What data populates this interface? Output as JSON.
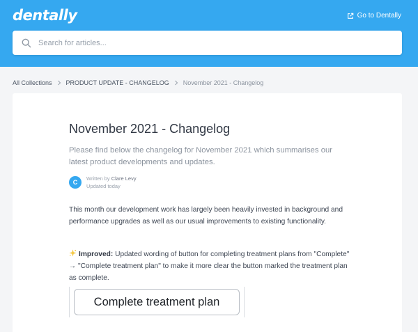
{
  "header": {
    "logo": "dentally",
    "goto_label": "Go to Dentally",
    "search_placeholder": "Search for articles..."
  },
  "breadcrumb": {
    "items": [
      "All Collections",
      "PRODUCT UPDATE - CHANGELOG",
      "November 2021 - Changelog"
    ]
  },
  "article": {
    "title": "November 2021 - Changelog",
    "description": "Please find below the changelog for November 2021 which summarises our latest product developments and updates.",
    "author": {
      "initial": "C",
      "written_by": "Written by",
      "name": "Clare Levy",
      "updated": "Updated today"
    },
    "paragraph1": "This month our development work has largely been heavily invested in background and performance upgrades as well as our usual improvements to existing functionality.",
    "improved_label": "Improved:",
    "improved_text": " Updated wording of button for completing treatment plans from \"Complete\" → \"Complete treatment plan\" to make it more clear the button marked the treatment plan as complete.",
    "screenshot_button": "Complete treatment plan"
  },
  "colors": {
    "header_bg": "#35a8f0",
    "page_bg": "#f4f5f7",
    "card_bg": "#ffffff"
  },
  "icons": {
    "external": "external-link-icon",
    "search": "search-icon",
    "chevron": "chevron-right-icon",
    "improved": "sparkle-icon"
  }
}
